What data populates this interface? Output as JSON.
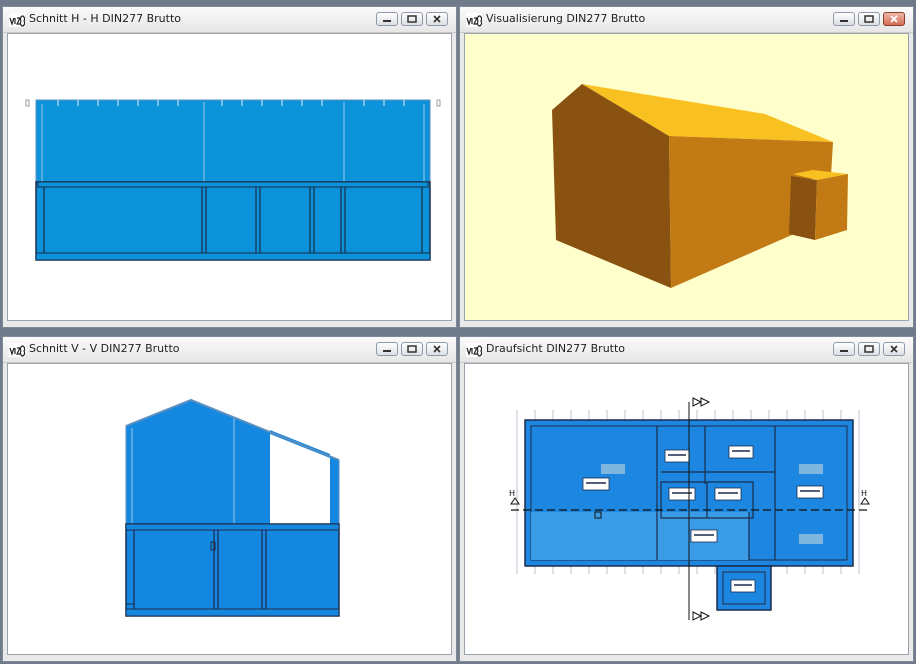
{
  "windows": {
    "section_h": {
      "title": "Schnitt H - H DIN277 Brutto",
      "icon": "vizo-app-icon"
    },
    "visualization": {
      "title": "Visualisierung DIN277 Brutto",
      "icon": "vizo-app-icon"
    },
    "section_v": {
      "title": "Schnitt V - V DIN277 Brutto",
      "icon": "vizo-app-icon"
    },
    "plan": {
      "title": "Draufsicht DIN277 Brutto",
      "icon": "vizo-app-icon"
    }
  },
  "plan": {
    "section_label_h": "H",
    "colors": {
      "room_fill": "#1c86e0",
      "outline": "#1b2c4a"
    }
  },
  "colors": {
    "section_fill": "#0b92d8",
    "model_front": "#c27a14",
    "model_side": "#8a5210",
    "model_roof": "#f8c020",
    "viewport_bg": "#ffffcc"
  }
}
